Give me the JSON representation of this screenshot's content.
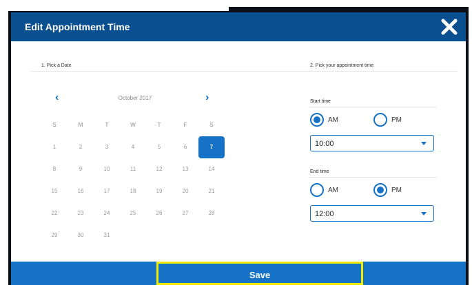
{
  "dialog": {
    "title": "Edit Appointment Time",
    "close_icon": "close-icon",
    "save_label": "Save",
    "colors": {
      "header": "#0a4f8f",
      "accent": "#1572c6",
      "highlight": "#f2ec00"
    }
  },
  "date_section": {
    "label": "1. Pick a Date"
  },
  "time_section": {
    "label": "2. Pick your appointment time"
  },
  "calendar": {
    "month_label": "October 2017",
    "prev_icon": "chevron-left-icon",
    "next_icon": "chevron-right-icon",
    "weekdays": [
      "S",
      "M",
      "T",
      "W",
      "T",
      "F",
      "S"
    ],
    "weeks": [
      [
        "1",
        "2",
        "3",
        "4",
        "5",
        "6",
        "7"
      ],
      [
        "8",
        "9",
        "10",
        "11",
        "12",
        "13",
        "14"
      ],
      [
        "15",
        "16",
        "17",
        "18",
        "19",
        "20",
        "21"
      ],
      [
        "22",
        "23",
        "24",
        "25",
        "26",
        "27",
        "28"
      ],
      [
        "29",
        "30",
        "31"
      ]
    ],
    "selected_day": "7"
  },
  "start_time": {
    "label": "Start time",
    "am_label": "AM",
    "pm_label": "PM",
    "selected_period": "AM",
    "value": "10:00"
  },
  "end_time": {
    "label": "End time",
    "am_label": "AM",
    "pm_label": "PM",
    "selected_period": "PM",
    "value": "12:00"
  }
}
